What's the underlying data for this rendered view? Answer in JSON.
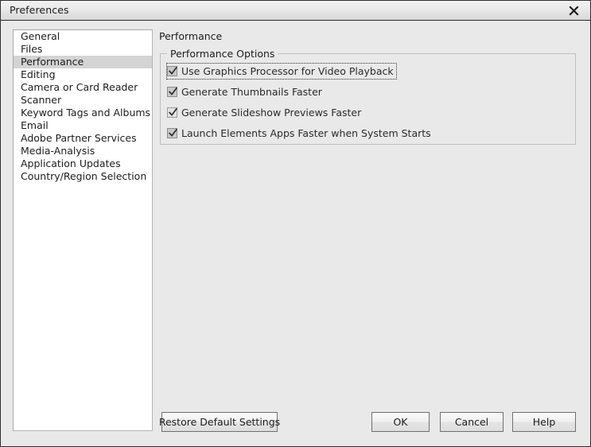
{
  "window": {
    "title": "Preferences",
    "close_icon": "close-x-icon"
  },
  "sidebar": {
    "items": [
      {
        "label": "General",
        "selected": false
      },
      {
        "label": "Files",
        "selected": false
      },
      {
        "label": "Performance",
        "selected": true
      },
      {
        "label": "Editing",
        "selected": false
      },
      {
        "label": "Camera or Card Reader",
        "selected": false
      },
      {
        "label": "Scanner",
        "selected": false
      },
      {
        "label": "Keyword Tags and Albums",
        "selected": false
      },
      {
        "label": "Email",
        "selected": false
      },
      {
        "label": "Adobe Partner Services",
        "selected": false
      },
      {
        "label": "Media-Analysis",
        "selected": false
      },
      {
        "label": "Application Updates",
        "selected": false
      },
      {
        "label": "Country/Region Selection",
        "selected": false
      }
    ]
  },
  "main": {
    "pane_title": "Performance",
    "group": {
      "legend": "Performance Options",
      "options": [
        {
          "label": "Use Graphics Processor for Video Playback",
          "checked": true,
          "focused": true,
          "style": "grey"
        },
        {
          "label": "Generate Thumbnails Faster",
          "checked": true,
          "focused": false,
          "style": "grey"
        },
        {
          "label": "Generate Slideshow Previews Faster",
          "checked": true,
          "focused": false,
          "style": "light"
        },
        {
          "label": "Launch Elements Apps Faster when System Starts",
          "checked": true,
          "focused": false,
          "style": "grey"
        }
      ]
    }
  },
  "buttons": {
    "restore": "Restore Default Settings",
    "ok": "OK",
    "cancel": "Cancel",
    "help": "Help"
  },
  "colors": {
    "window_background": "#e9e9e9",
    "list_background": "#ffffff",
    "selection": "#d4d4d4",
    "border": "#2e2e2e",
    "text": "#1c1c1c"
  }
}
